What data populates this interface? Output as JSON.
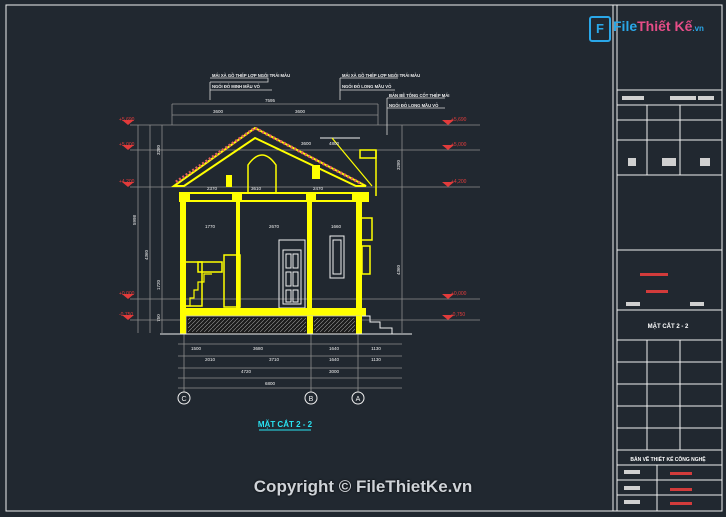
{
  "drawing": {
    "title": "MẶT CẮT 2 - 2",
    "notes": {
      "roof_left_line1": "MÁI XÀ GỒ THÉP LỢP NGÓI TRÁI MÀU",
      "roof_left_line2": "NGÓI ĐỎ MINH MẦU VỎ",
      "roof_right_line1": "MÁI XÀ GỒ THÉP LỢP NGÓI TRÁI MÀU",
      "roof_right_line2": "NGÓI ĐỎ LONG MẦU VỎ",
      "canopy_line1": "BẢN BÊ TÔNG CỐT THÉP MÁI",
      "canopy_line2": "NGÓI ĐỎ LONG MẦU VỎ"
    },
    "levels_left": [
      "+5,690",
      "+5,000",
      "+4,200",
      "+0,000",
      "-0,750"
    ],
    "levels_right": [
      "+5,690",
      "+5,000",
      "+4,200",
      "+0,000",
      "-0,750"
    ],
    "top_dims": [
      "7595",
      "3600",
      "3600",
      "3600",
      "4800"
    ],
    "left_dims": [
      "5998",
      "4360",
      "3280",
      "1720",
      "750"
    ],
    "right_dims": [
      "3280",
      "4360"
    ],
    "inner_dims": [
      "2370",
      "3610",
      "2470",
      "1770",
      "2670",
      "1660"
    ],
    "bottom_dims_row1": [
      "1500",
      "3680",
      "1640",
      "1130"
    ],
    "bottom_dims_row2": [
      "2010",
      "3710",
      "1640",
      "1130"
    ],
    "bottom_dims_row3": [
      "4720",
      "3000"
    ],
    "bottom_total": "6800",
    "grid_axes": [
      "C",
      "B",
      "A"
    ]
  },
  "title_block": {
    "sheet_title": "MẶT CẮT 2 - 2",
    "project_name": "BẢN VẼ THIẾT KẾ CÔNG NGHỆ"
  },
  "logo": {
    "mark": "F",
    "name_part1": "File",
    "name_part2": "Thiết Kế",
    "suffix": ".vn"
  },
  "watermark": "Copyright © FileThietKe.vn",
  "colors": {
    "background": "#212830",
    "frame": "#f0f0f0",
    "structure": "#ffff00",
    "dimension": "#8e8e8e",
    "label": "#f0f0f0",
    "level_marker": "#e23b3b",
    "title": "#29e3f2",
    "roof_tiles": "#e0605c"
  }
}
